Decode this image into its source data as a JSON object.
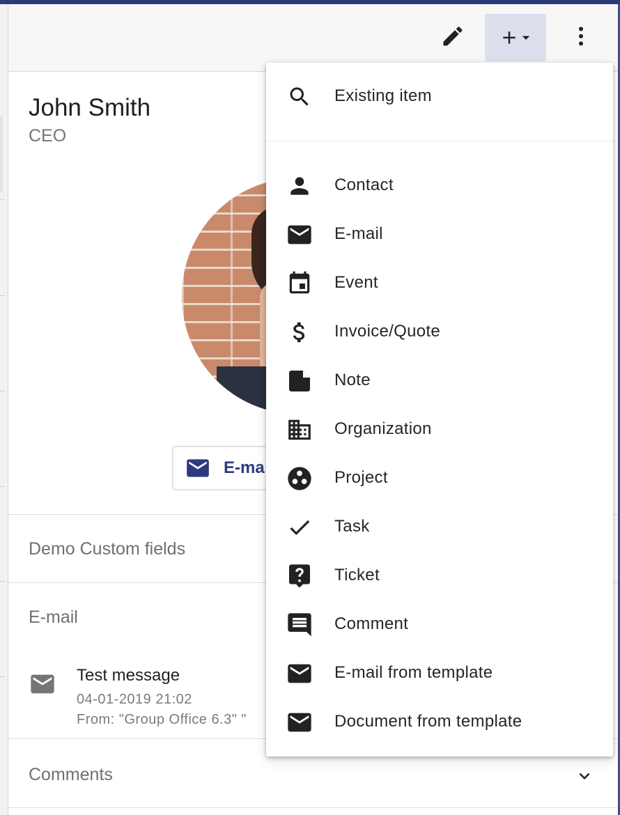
{
  "contact": {
    "name": "John Smith",
    "role": "CEO"
  },
  "actions": {
    "email_button_label": "E-ma"
  },
  "sections": {
    "custom_fields_title": "Demo Custom fields",
    "email_title": "E-mail",
    "comments_title": "Comments"
  },
  "email_item": {
    "subject": "Test message",
    "date": "04-01-2019 21:02",
    "from": "From: \"Group Office 6.3\" \""
  },
  "add_menu": {
    "existing": {
      "label": "Existing item",
      "icon": "search-icon"
    },
    "items": [
      {
        "label": "Contact",
        "icon": "person-icon"
      },
      {
        "label": "E-mail",
        "icon": "mail-icon"
      },
      {
        "label": "Event",
        "icon": "calendar-icon"
      },
      {
        "label": "Invoice/Quote",
        "icon": "dollar-icon"
      },
      {
        "label": "Note",
        "icon": "note-icon"
      },
      {
        "label": "Organization",
        "icon": "building-icon"
      },
      {
        "label": "Project",
        "icon": "project-icon"
      },
      {
        "label": "Task",
        "icon": "check-icon"
      },
      {
        "label": "Ticket",
        "icon": "ticket-icon"
      },
      {
        "label": "Comment",
        "icon": "comment-icon"
      },
      {
        "label": "E-mail from template",
        "icon": "mail-icon"
      },
      {
        "label": "Document from template",
        "icon": "mail-icon"
      }
    ]
  },
  "colors": {
    "accent": "#2d3b7e",
    "active_button_bg": "#dde0ec",
    "icon": "#222222"
  }
}
